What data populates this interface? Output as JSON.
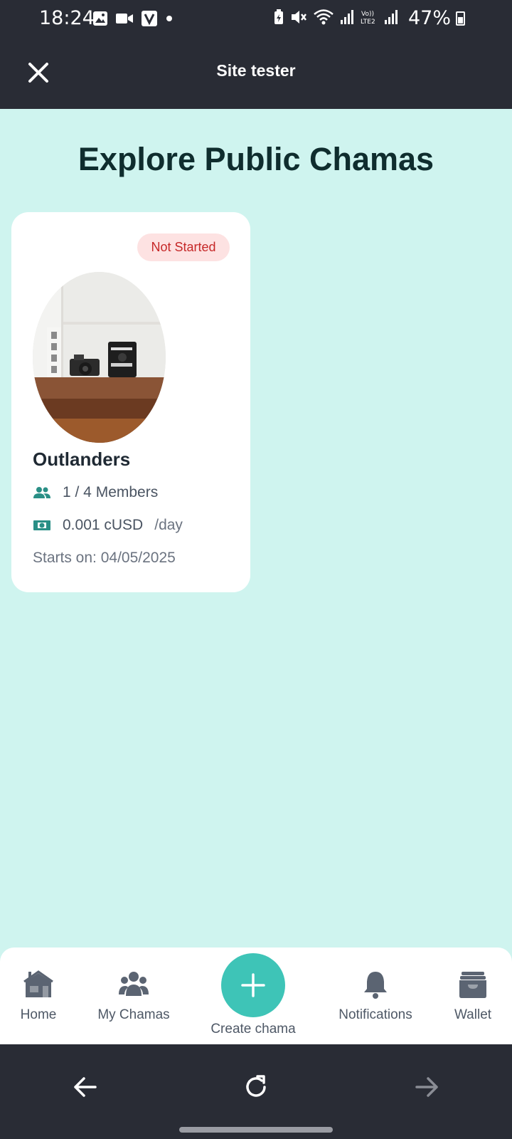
{
  "status_bar": {
    "time": "18:24",
    "battery": "47%",
    "left_icons": [
      "image-icon",
      "video-icon",
      "v-app-icon",
      "dot-icon"
    ],
    "right_icons": [
      "battery-saver-icon",
      "mute-icon",
      "wifi-icon",
      "signal-icon",
      "volte-icon",
      "signal-icon"
    ]
  },
  "app_bar": {
    "title": "Site tester",
    "close_icon": "close-icon"
  },
  "page": {
    "title": "Explore Public Chamas"
  },
  "chamas": [
    {
      "status": "Not Started",
      "name": "Outlanders",
      "members": "1 / 4 Members",
      "amount": "0.001 cUSD",
      "frequency": "/day",
      "starts_on": "Starts on: 04/05/2025"
    }
  ],
  "bottom_nav": {
    "home": "Home",
    "my_chamas": "My Chamas",
    "create": "Create chama",
    "notifications": "Notifications",
    "wallet": "Wallet"
  },
  "colors": {
    "background": "#cff4ef",
    "dark_bar": "#292c35",
    "accent": "#3ec4b7",
    "badge_bg": "#fde2e2",
    "badge_text": "#c62828",
    "icon_teal": "#2a8f86"
  }
}
